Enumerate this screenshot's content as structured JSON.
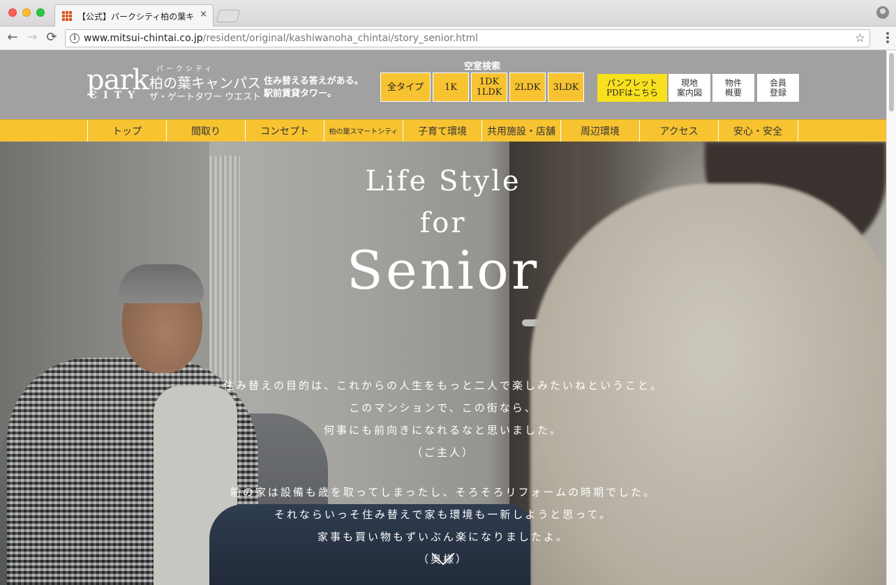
{
  "browser": {
    "tab_title": "【公式】パークシティ柏の葉キャンパス",
    "tab_close": "×",
    "url_host": "www.mitsui-chintai.co.jp",
    "url_path": "/resident/original/kashiwanoha_chintai/story_senior.html",
    "back_icon": "←",
    "forward_icon": "→",
    "reload_icon": "C",
    "info_icon": "i",
    "star_icon": "☆"
  },
  "header": {
    "logo": {
      "park": "park",
      "city": "CITY",
      "kana": "パークシティ",
      "name": "柏の葉キャンパス",
      "sub": "ザ・ゲートタワー ウエスト"
    },
    "tagline_1": "住み替える答えがある。",
    "tagline_2": "駅前賃貸タワー。",
    "vacancy_title": "空室検索",
    "type_buttons": [
      {
        "label": "全タイプ"
      },
      {
        "label": "1K"
      },
      {
        "label": "1DK\n1LDK"
      },
      {
        "label": "2LDK"
      },
      {
        "label": "3LDK"
      }
    ],
    "util_buttons": [
      {
        "label": "パンフレット\nPDFはこちら"
      },
      {
        "label": "現地\n案内図"
      },
      {
        "label": "物件\n概要"
      },
      {
        "label": "会員\n登録"
      }
    ]
  },
  "global_nav": [
    {
      "label": "トップ"
    },
    {
      "label": "間取り"
    },
    {
      "label": "コンセプト"
    },
    {
      "label": "柏の葉スマートシティ"
    },
    {
      "label": "子育て環境"
    },
    {
      "label": "共用施設・店舗"
    },
    {
      "label": "周辺環境"
    },
    {
      "label": "アクセス"
    },
    {
      "label": "安心・安全"
    }
  ],
  "hero": {
    "title_1": "Life Style",
    "title_2": "for",
    "title_3": "Senior",
    "story_husband": [
      "住み替えの目的は、これからの人生をもっと二人で楽しみたいねということ。",
      "このマンションで、この街なら、",
      "何事にも前向きになれるなと思いました。",
      "（ご主人）"
    ],
    "story_wife": [
      "前の家は設備も歳を取ってしまったし、そろそろリフォームの時期でした。",
      "それならいっそ住み替えで家も環境も一新しようと思って。",
      "家事も買い物もずいぶん楽になりましたよ。",
      "（奥様）"
    ]
  },
  "colors": {
    "brand_yellow": "#f7c331",
    "pamphlet_yellow": "#f9e01e",
    "header_gray": "#a1a1a1"
  }
}
